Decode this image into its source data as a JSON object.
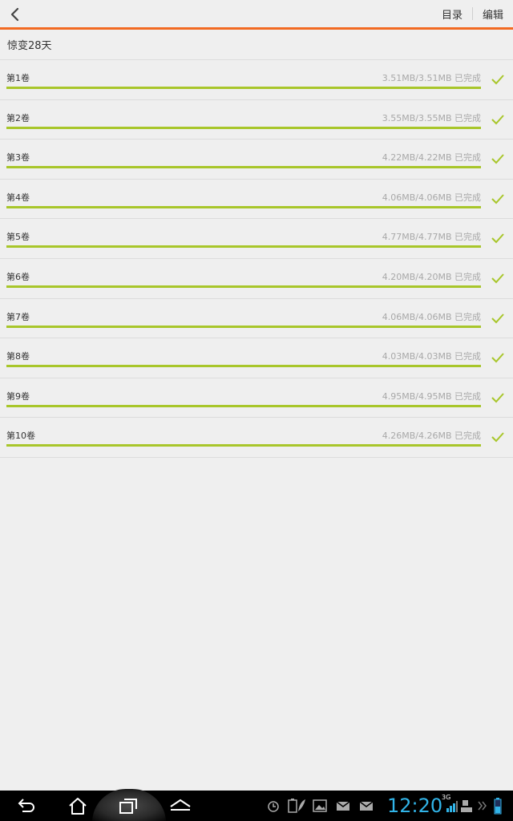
{
  "header": {
    "catalog_label": "目录",
    "edit_label": "编辑"
  },
  "book": {
    "title": "惊变28天"
  },
  "volumes": [
    {
      "name": "第1卷",
      "status": "3.51MB/3.51MB 已完成",
      "progress": 1.0
    },
    {
      "name": "第2卷",
      "status": "3.55MB/3.55MB 已完成",
      "progress": 1.0
    },
    {
      "name": "第3卷",
      "status": "4.22MB/4.22MB 已完成",
      "progress": 1.0
    },
    {
      "name": "第4卷",
      "status": "4.06MB/4.06MB 已完成",
      "progress": 1.0
    },
    {
      "name": "第5卷",
      "status": "4.77MB/4.77MB 已完成",
      "progress": 1.0
    },
    {
      "name": "第6卷",
      "status": "4.20MB/4.20MB 已完成",
      "progress": 1.0
    },
    {
      "name": "第7卷",
      "status": "4.06MB/4.06MB 已完成",
      "progress": 1.0
    },
    {
      "name": "第8卷",
      "status": "4.03MB/4.03MB 已完成",
      "progress": 1.0
    },
    {
      "name": "第9卷",
      "status": "4.95MB/4.95MB 已完成",
      "progress": 1.0
    },
    {
      "name": "第10卷",
      "status": "4.26MB/4.26MB 已完成",
      "progress": 1.0
    }
  ],
  "system_bar": {
    "time": "12:20",
    "network": "3G"
  },
  "colors": {
    "accent": "#f26a22",
    "progress": "#a8c62a",
    "clock": "#31b4e8"
  },
  "icons": {
    "back": "chevron-left-icon",
    "done": "check-icon"
  }
}
